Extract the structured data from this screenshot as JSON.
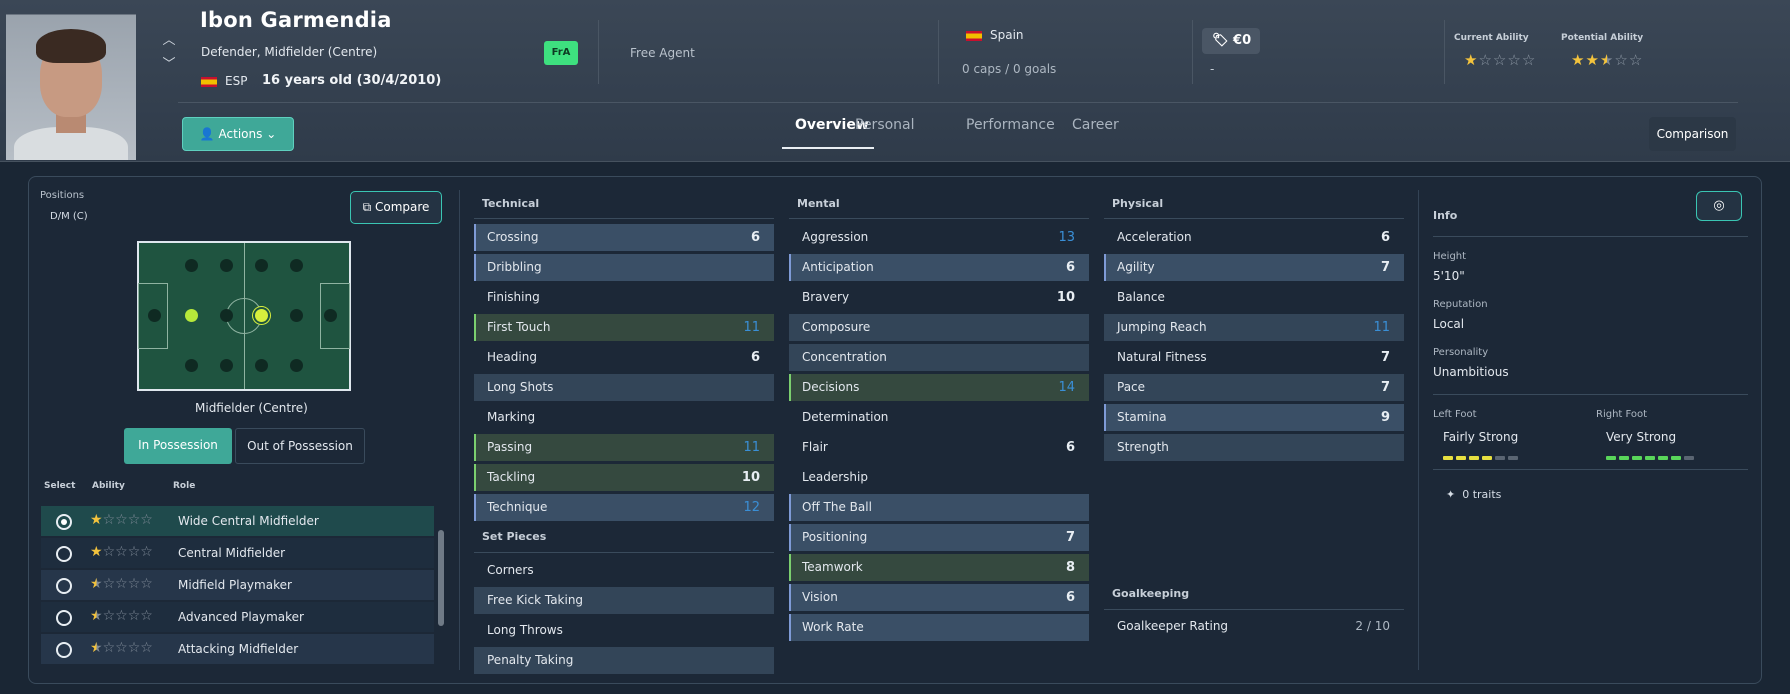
{
  "player": {
    "name": "Ibon Garmendia",
    "positions": "Defender, Midfielder (Centre)",
    "nationality_code": "ESP",
    "age": "16 years old (30/4/2010)",
    "badge": "FrA",
    "contract": "Free Agent",
    "nation": "Spain",
    "caps": "0 caps / 0 goals",
    "value": "€0",
    "value_sub": "-",
    "current_ability_label": "Current Ability",
    "potential_ability_label": "Potential Ability",
    "current_ability_stars": 1,
    "potential_ability_stars": 2.5
  },
  "header": {
    "actions_label": "Actions",
    "tabs": [
      "Overview",
      "Personal",
      "Performance",
      "Career"
    ],
    "active_tab": "Overview",
    "comparison_label": "Comparison"
  },
  "positions_panel": {
    "label": "Positions",
    "position_code": "D/M (C)",
    "compare_label": "Compare",
    "pitch_label": "Midfielder (Centre)",
    "in_possession": "In Possession",
    "out_of_possession": "Out of Possession",
    "col_select": "Select",
    "col_ability": "Ability",
    "col_role": "Role",
    "roles": [
      {
        "name": "Wide Central Midfielder",
        "stars": 1,
        "selected": true
      },
      {
        "name": "Central Midfielder",
        "stars": 1,
        "selected": false
      },
      {
        "name": "Midfield Playmaker",
        "stars": 0.5,
        "selected": false
      },
      {
        "name": "Advanced Playmaker",
        "stars": 0.5,
        "selected": false
      },
      {
        "name": "Attacking Midfielder",
        "stars": 0.5,
        "selected": false
      }
    ]
  },
  "attributes": {
    "technical_label": "Technical",
    "technical": [
      {
        "name": "Crossing",
        "value": "6"
      },
      {
        "name": "Dribbling",
        "value": ""
      },
      {
        "name": "Finishing",
        "value": ""
      },
      {
        "name": "First Touch",
        "value": "11"
      },
      {
        "name": "Heading",
        "value": "6"
      },
      {
        "name": "Long Shots",
        "value": ""
      },
      {
        "name": "Marking",
        "value": ""
      },
      {
        "name": "Passing",
        "value": "11"
      },
      {
        "name": "Tackling",
        "value": "10"
      },
      {
        "name": "Technique",
        "value": "12"
      }
    ],
    "set_pieces_label": "Set Pieces",
    "set_pieces": [
      {
        "name": "Corners",
        "value": ""
      },
      {
        "name": "Free Kick Taking",
        "value": ""
      },
      {
        "name": "Long Throws",
        "value": ""
      },
      {
        "name": "Penalty Taking",
        "value": ""
      }
    ],
    "mental_label": "Mental",
    "mental": [
      {
        "name": "Aggression",
        "value": "13"
      },
      {
        "name": "Anticipation",
        "value": "6"
      },
      {
        "name": "Bravery",
        "value": "10"
      },
      {
        "name": "Composure",
        "value": ""
      },
      {
        "name": "Concentration",
        "value": ""
      },
      {
        "name": "Decisions",
        "value": "14"
      },
      {
        "name": "Determination",
        "value": ""
      },
      {
        "name": "Flair",
        "value": "6"
      },
      {
        "name": "Leadership",
        "value": ""
      },
      {
        "name": "Off The Ball",
        "value": ""
      },
      {
        "name": "Positioning",
        "value": "7"
      },
      {
        "name": "Teamwork",
        "value": "8"
      },
      {
        "name": "Vision",
        "value": "6"
      },
      {
        "name": "Work Rate",
        "value": ""
      }
    ],
    "physical_label": "Physical",
    "physical": [
      {
        "name": "Acceleration",
        "value": "6"
      },
      {
        "name": "Agility",
        "value": "7"
      },
      {
        "name": "Balance",
        "value": ""
      },
      {
        "name": "Jumping Reach",
        "value": "11"
      },
      {
        "name": "Natural Fitness",
        "value": "7"
      },
      {
        "name": "Pace",
        "value": "7"
      },
      {
        "name": "Stamina",
        "value": "9"
      },
      {
        "name": "Strength",
        "value": ""
      }
    ],
    "goalkeeping_label": "Goalkeeping",
    "goalkeeper_rating_label": "Goalkeeper Rating",
    "goalkeeper_rating": "2 / 10"
  },
  "info": {
    "title": "Info",
    "height_label": "Height",
    "height": "5'10\"",
    "reputation_label": "Reputation",
    "reputation": "Local",
    "personality_label": "Personality",
    "personality": "Unambitious",
    "left_foot_label": "Left Foot",
    "left_foot": "Fairly Strong",
    "left_foot_level": 4,
    "right_foot_label": "Right Foot",
    "right_foot": "Very Strong",
    "right_foot_level": 6,
    "traits": "0 traits"
  },
  "colors": {
    "accent": "#3fa898",
    "star": "#f3c33d",
    "left_foot": "#e7e040",
    "right_foot": "#59d65a"
  }
}
